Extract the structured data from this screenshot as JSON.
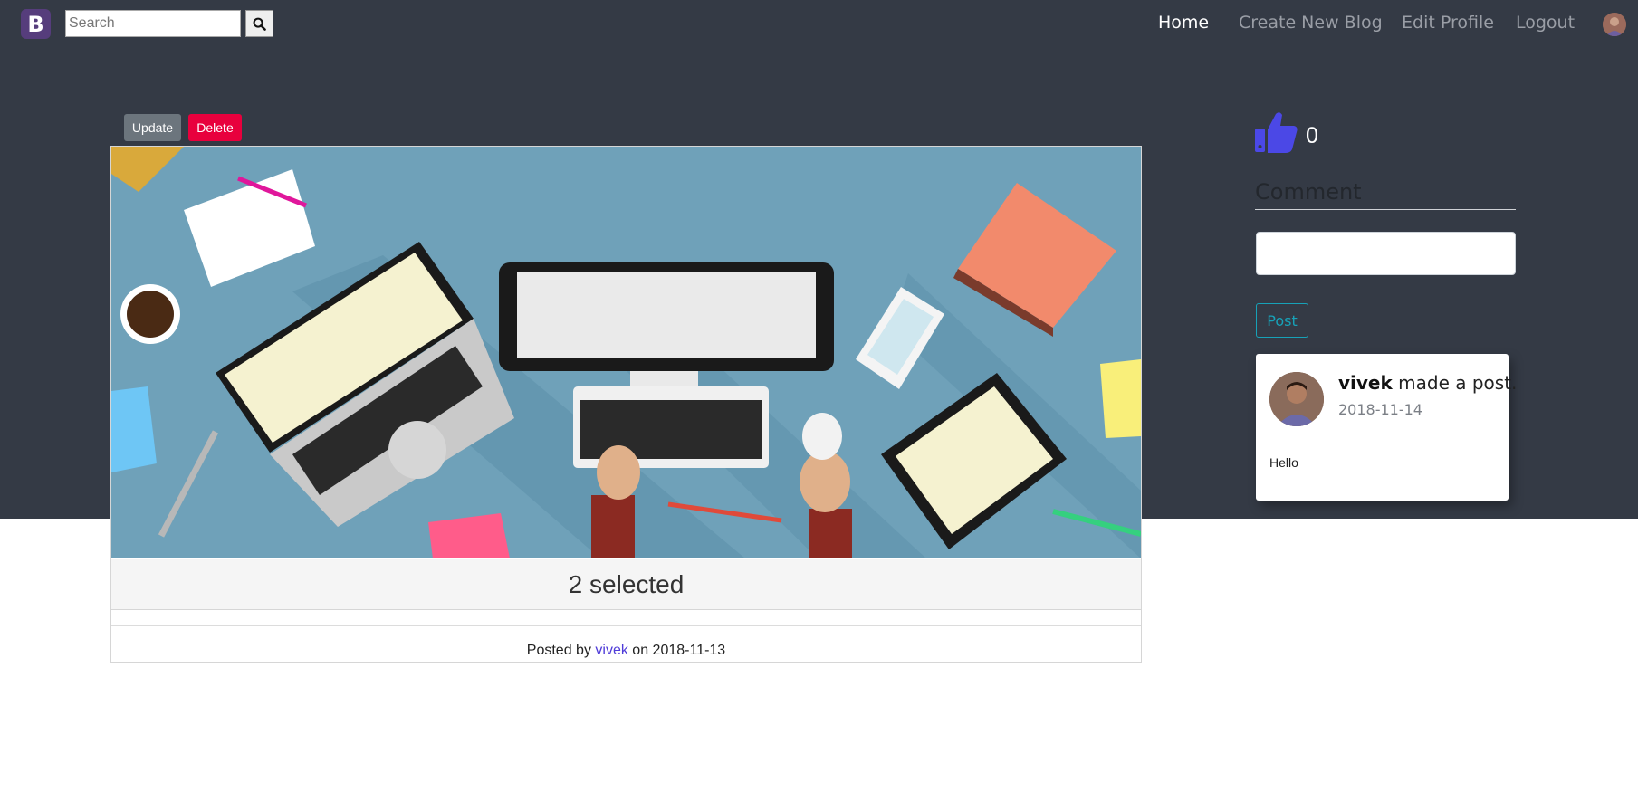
{
  "navbar": {
    "logo_letter": "B",
    "search_placeholder": "Search",
    "links": [
      {
        "label": "Home",
        "active": true
      },
      {
        "label": "Create New Blog",
        "active": false
      },
      {
        "label": "Edit Profile",
        "active": false
      },
      {
        "label": "Logout",
        "active": false
      }
    ]
  },
  "actions": {
    "update_label": "Update",
    "delete_label": "Delete"
  },
  "post": {
    "title": "2 selected",
    "posted_by_prefix": "Posted by",
    "author": "vivek",
    "on_text": "on",
    "date": "2018-11-13"
  },
  "likes": {
    "count": "0"
  },
  "comment": {
    "label": "Comment",
    "button_label": "Post"
  },
  "activity": {
    "user": "vivek",
    "action": "made a post.",
    "date": "2018-11-14",
    "text": "Hello"
  },
  "colors": {
    "header_bg": "#343a45",
    "like_icon": "#4b48e6",
    "delete": "#e8003d",
    "update": "#6c757d",
    "post_button": "#17a2b8",
    "author_link": "#4f3cd8"
  }
}
